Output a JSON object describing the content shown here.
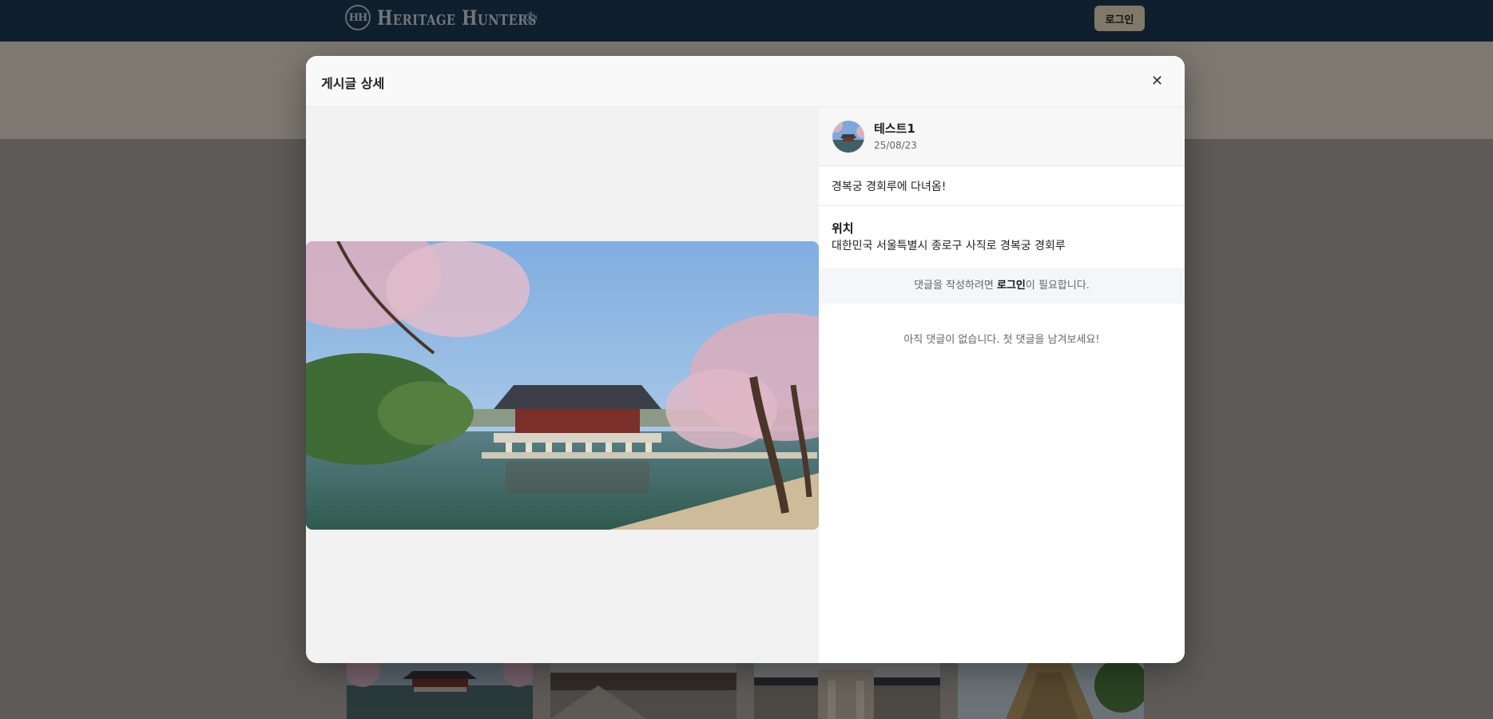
{
  "header": {
    "brand_logo_text": "HH",
    "brand_name": "Heritage Hunters",
    "login_label": "로그인"
  },
  "modal": {
    "title": "게시글 상세",
    "close_label": "✕",
    "post": {
      "author": "테스트1",
      "date": "25/08/23",
      "content": "경복궁 경회루에 다녀옴!",
      "location_title": "위치",
      "location_address": "대한민국 서울특별시 종로구 사직로 경복궁 경회루"
    },
    "comments": {
      "login_prefix": "댓글을 작성하려면 ",
      "login_link": "로그인",
      "login_suffix": "이 필요합니다.",
      "empty_text": "아직 댓글이 없습니다. 첫 댓글을 남겨보세요!"
    }
  },
  "icons": {
    "mute": "speaker-muted-icon",
    "close": "close-icon"
  },
  "colors": {
    "topbar": "#1d3a55",
    "login_button": "#e9dcc0",
    "hero_band": "#e3ddcd"
  }
}
